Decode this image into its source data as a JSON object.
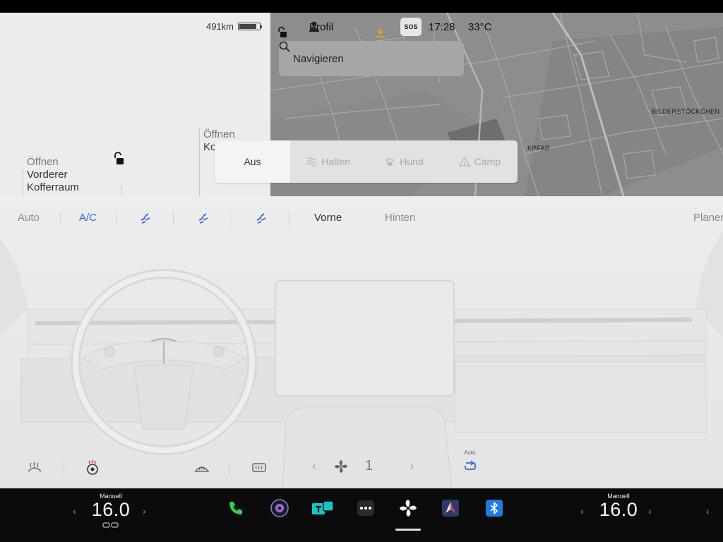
{
  "car": {
    "range": "491km",
    "battery_level": 0.85,
    "front_trunk": {
      "action": "Öffnen",
      "label_line1": "Vorderer",
      "label_line2": "Kofferraum"
    },
    "rear_trunk": {
      "action": "Öffnen",
      "label_partial": "Ko"
    }
  },
  "status": {
    "profile": "Profil",
    "sos": "SOS",
    "time": "17:28",
    "outside_temp": "33°C"
  },
  "navigation": {
    "search_placeholder": "Navigieren",
    "map_labels": [
      "BILDERSTÖCKCHEN",
      "KPFAD"
    ]
  },
  "climate_modes": {
    "active": "Aus",
    "items": [
      "Aus",
      "Halten",
      "Hund",
      "Camp"
    ]
  },
  "climate": {
    "auto": "Auto",
    "ac": "A/C",
    "tab_front": "Vorne",
    "tab_rear": "Hinten",
    "planer": "Planer",
    "fan_speed": "1",
    "recirc_label": "Auto",
    "accent_color": "#3a63d8"
  },
  "dock": {
    "driver_mode": "Manuell",
    "driver_temp": "16.0",
    "passenger_mode": "Manuell",
    "passenger_temp": "16.0",
    "apps": [
      "phone-icon",
      "camera-icon",
      "toybox-icon",
      "more-icon",
      "fan-icon",
      "navigation-icon",
      "bluetooth-icon"
    ]
  }
}
